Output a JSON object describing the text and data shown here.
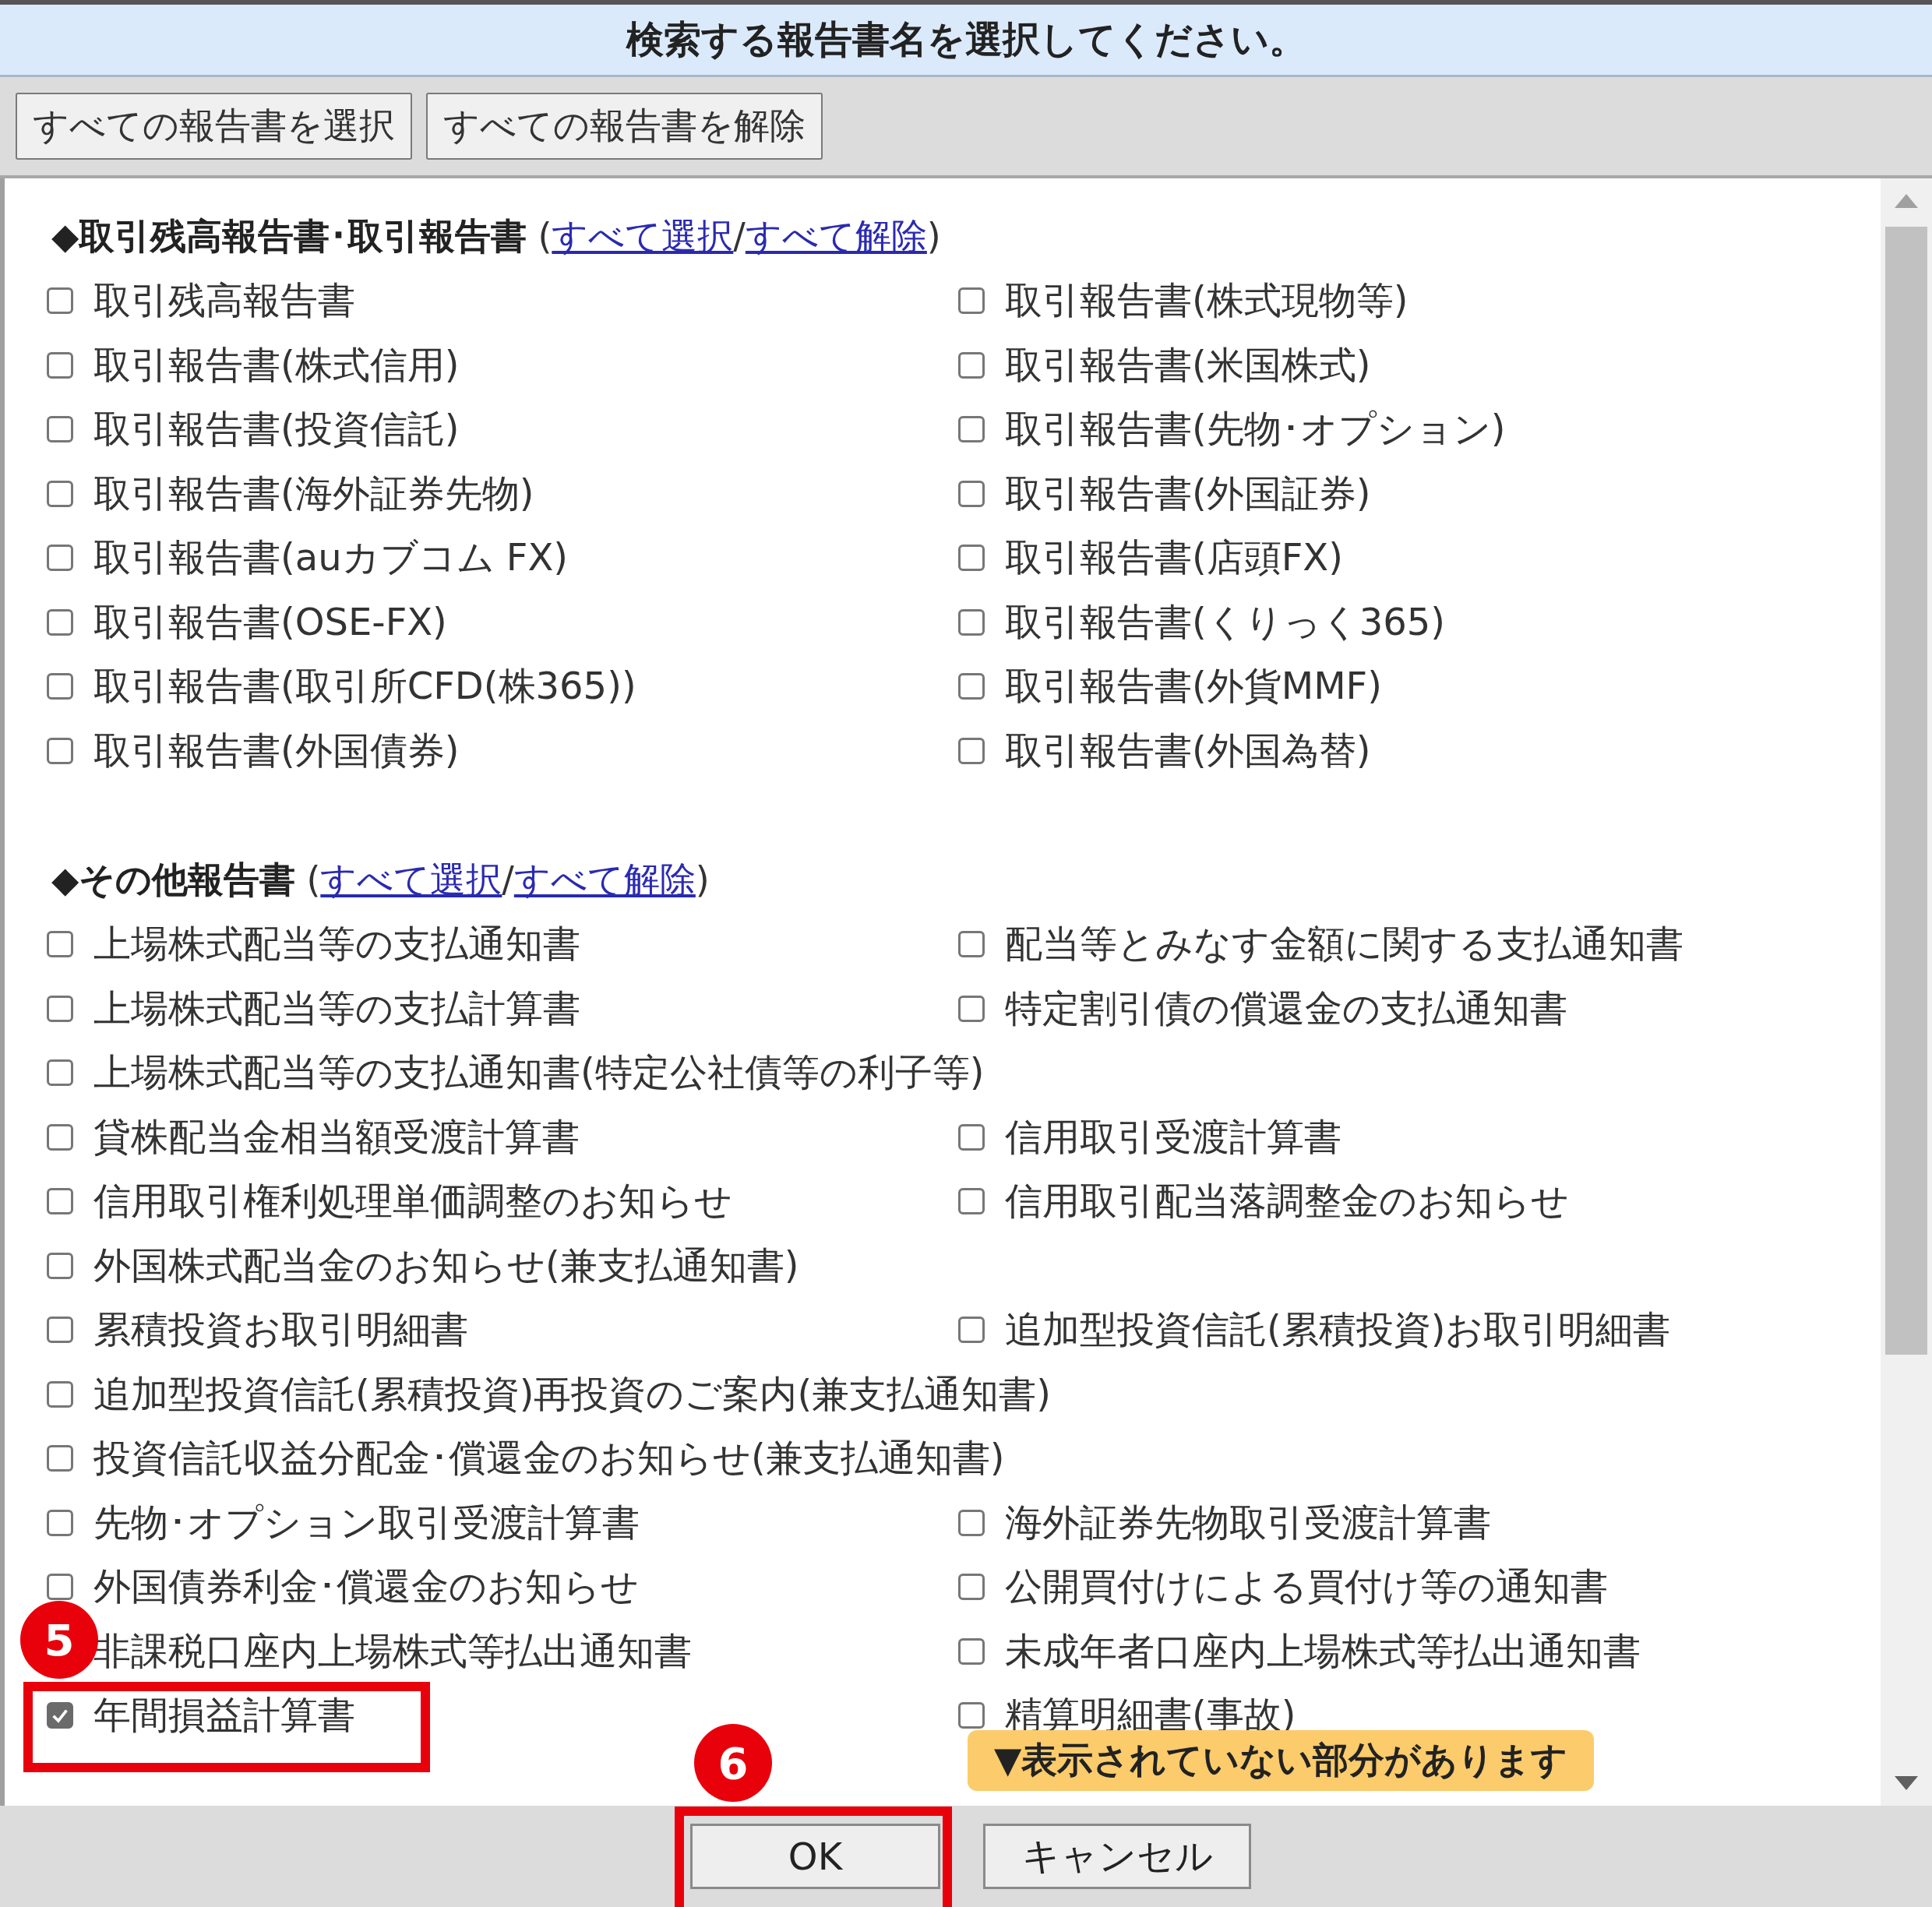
{
  "title": "検索する報告書名を選択してください。",
  "toolbar": {
    "buttons": [
      "すべての報告書を選択",
      "すべての報告書を解除"
    ]
  },
  "sections": [
    {
      "heading": "◆取引残高報告書･取引報告書",
      "open_paren": "(",
      "close_paren": ")",
      "select_all_link": "すべて選択",
      "separator": "/",
      "deselect_all_link": "すべて解除",
      "rows": [
        [
          {
            "label": "取引残高報告書",
            "checked": false
          },
          {
            "label": "取引報告書(株式現物等)",
            "checked": false
          }
        ],
        [
          {
            "label": "取引報告書(株式信用)",
            "checked": false
          },
          {
            "label": "取引報告書(米国株式)",
            "checked": false
          }
        ],
        [
          {
            "label": "取引報告書(投資信託)",
            "checked": false
          },
          {
            "label": "取引報告書(先物･オプション)",
            "checked": false
          }
        ],
        [
          {
            "label": "取引報告書(海外証券先物)",
            "checked": false
          },
          {
            "label": "取引報告書(外国証券)",
            "checked": false
          }
        ],
        [
          {
            "label": "取引報告書(auカブコム FX)",
            "checked": false
          },
          {
            "label": "取引報告書(店頭FX)",
            "checked": false
          }
        ],
        [
          {
            "label": "取引報告書(OSE-FX)",
            "checked": false
          },
          {
            "label": "取引報告書(くりっく365)",
            "checked": false
          }
        ],
        [
          {
            "label": "取引報告書(取引所CFD(株365))",
            "checked": false
          },
          {
            "label": "取引報告書(外貨MMF)",
            "checked": false
          }
        ],
        [
          {
            "label": "取引報告書(外国債券)",
            "checked": false
          },
          {
            "label": "取引報告書(外国為替)",
            "checked": false
          }
        ]
      ]
    },
    {
      "heading": "◆その他報告書",
      "open_paren": "(",
      "close_paren": ")",
      "select_all_link": "すべて選択",
      "separator": "/",
      "deselect_all_link": "すべて解除",
      "rows": [
        [
          {
            "label": "上場株式配当等の支払通知書",
            "checked": false
          },
          {
            "label": "配当等とみなす金額に関する支払通知書",
            "checked": false
          }
        ],
        [
          {
            "label": "上場株式配当等の支払計算書",
            "checked": false
          },
          {
            "label": "特定割引債の償還金の支払通知書",
            "checked": false
          }
        ],
        [
          {
            "label": "上場株式配当等の支払通知書(特定公社債等の利子等)",
            "checked": false
          }
        ],
        [
          {
            "label": "貸株配当金相当額受渡計算書",
            "checked": false
          },
          {
            "label": "信用取引受渡計算書",
            "checked": false
          }
        ],
        [
          {
            "label": "信用取引権利処理単価調整のお知らせ",
            "checked": false
          },
          {
            "label": "信用取引配当落調整金のお知らせ",
            "checked": false
          }
        ],
        [
          {
            "label": "外国株式配当金のお知らせ(兼支払通知書)",
            "checked": false
          }
        ],
        [
          {
            "label": "累積投資お取引明細書",
            "checked": false
          },
          {
            "label": "追加型投資信託(累積投資)お取引明細書",
            "checked": false
          }
        ],
        [
          {
            "label": "追加型投資信託(累積投資)再投資のご案内(兼支払通知書)",
            "checked": false
          }
        ],
        [
          {
            "label": "投資信託収益分配金･償還金のお知らせ(兼支払通知書)",
            "checked": false
          }
        ],
        [
          {
            "label": "先物･オプション取引受渡計算書",
            "checked": false
          },
          {
            "label": "海外証券先物取引受渡計算書",
            "checked": false
          }
        ],
        [
          {
            "label": "外国債券利金･償還金のお知らせ",
            "checked": false
          },
          {
            "label": "公開買付けによる買付け等の通知書",
            "checked": false
          }
        ],
        [
          {
            "label": "非課税口座内上場株式等払出通知書"
          },
          {
            "label": "未成年者口座内上場株式等払出通知書",
            "checked": false
          }
        ],
        [
          {
            "label": "年間損益計算書",
            "checked": true,
            "callout": "5"
          },
          {
            "label": "精算明細書(事故)",
            "checked": false
          }
        ]
      ]
    }
  ],
  "notice": "▼表示されていない部分があります",
  "footer": {
    "ok": "OK",
    "ok_callout": "6",
    "cancel": "キャンセル"
  }
}
